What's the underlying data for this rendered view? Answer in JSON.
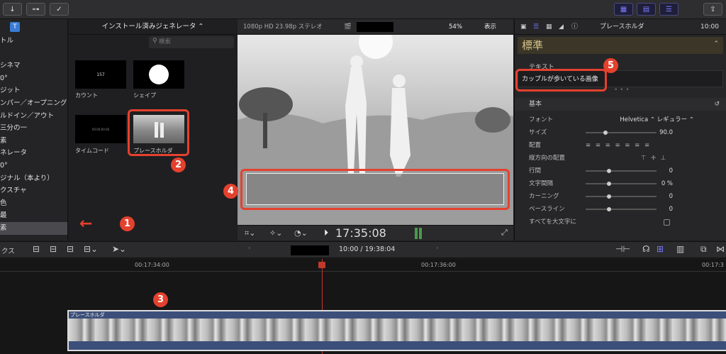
{
  "toolbar": {
    "import_icon": "↓",
    "keywords_icon": "⊶",
    "check_icon": "✓",
    "share_icon": "⇪"
  },
  "sidebar": {
    "items": [
      "トル",
      "",
      "シネマ",
      "0°",
      "ジット",
      "ンパー／オープニング",
      "ルドイン／アウト",
      "三分の一",
      "素",
      "ネレータ",
      "0°",
      "ジナル（本より）",
      "クスチャ",
      "色",
      "最",
      "素"
    ]
  },
  "generators": {
    "header": "インストール済みジェネレータ ⌃",
    "search_placeholder": "検索",
    "items": [
      {
        "label": "カウント",
        "thumb_text": "157"
      },
      {
        "label": "シェイプ",
        "thumb_text": ""
      },
      {
        "label": "タイムコード",
        "thumb_text": "00:00:00:00"
      },
      {
        "label": "プレースホルダ",
        "thumb_text": ""
      }
    ]
  },
  "viewer": {
    "format": "1080p HD 23.98p ステレオ",
    "zoom": "54%",
    "display": "表示",
    "timecode": "17:35:08"
  },
  "inspector": {
    "title": "プレースホルダ",
    "timecode": "10:00",
    "preset": "標準",
    "text_label": "テキスト",
    "text_value": "カップルが歩いている画像",
    "section_basic": "基本",
    "rows": [
      {
        "label": "フォント",
        "value": "Helvetica ⌃   レギュラー ⌃"
      },
      {
        "label": "サイズ",
        "value": "90.0"
      },
      {
        "label": "配置",
        "value": ""
      },
      {
        "label": "縦方向の配置",
        "value": ""
      },
      {
        "label": "行間",
        "value": "0"
      },
      {
        "label": "文字間隔",
        "value": "0 %"
      },
      {
        "label": "カーニング",
        "value": "0"
      },
      {
        "label": "ベースライン",
        "value": "0"
      },
      {
        "label": "すべてを大文字に",
        "value": ""
      }
    ],
    "slider_levels": [
      null,
      0.25,
      null,
      null,
      0.3,
      0.3,
      0.3,
      0.3,
      null
    ]
  },
  "timeline_bar": {
    "left_label": "クス",
    "timecode": "10:00 / 19:38:04"
  },
  "ruler": {
    "ticks": [
      "00:17:34:00",
      "00:17:36:00",
      "00:17:3"
    ]
  },
  "clip": {
    "name": "プレースホルダ"
  },
  "annotations": {
    "b1": "1",
    "b2": "2",
    "b3": "3",
    "b4": "4",
    "b5": "5",
    "arrow": "←"
  }
}
